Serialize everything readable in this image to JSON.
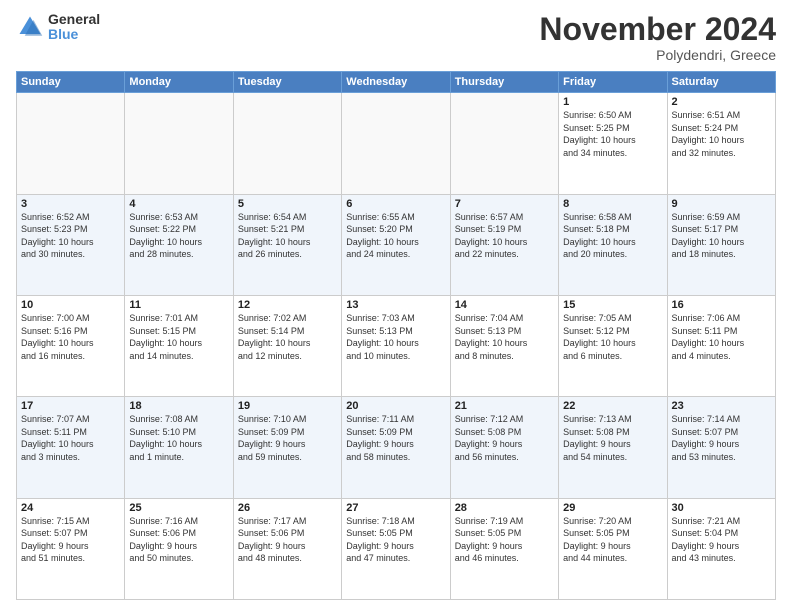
{
  "header": {
    "logo_general": "General",
    "logo_blue": "Blue",
    "month_title": "November 2024",
    "location": "Polydendri, Greece"
  },
  "days_of_week": [
    "Sunday",
    "Monday",
    "Tuesday",
    "Wednesday",
    "Thursday",
    "Friday",
    "Saturday"
  ],
  "weeks": [
    [
      {
        "day": "",
        "info": ""
      },
      {
        "day": "",
        "info": ""
      },
      {
        "day": "",
        "info": ""
      },
      {
        "day": "",
        "info": ""
      },
      {
        "day": "",
        "info": ""
      },
      {
        "day": "1",
        "info": "Sunrise: 6:50 AM\nSunset: 5:25 PM\nDaylight: 10 hours\nand 34 minutes."
      },
      {
        "day": "2",
        "info": "Sunrise: 6:51 AM\nSunset: 5:24 PM\nDaylight: 10 hours\nand 32 minutes."
      }
    ],
    [
      {
        "day": "3",
        "info": "Sunrise: 6:52 AM\nSunset: 5:23 PM\nDaylight: 10 hours\nand 30 minutes."
      },
      {
        "day": "4",
        "info": "Sunrise: 6:53 AM\nSunset: 5:22 PM\nDaylight: 10 hours\nand 28 minutes."
      },
      {
        "day": "5",
        "info": "Sunrise: 6:54 AM\nSunset: 5:21 PM\nDaylight: 10 hours\nand 26 minutes."
      },
      {
        "day": "6",
        "info": "Sunrise: 6:55 AM\nSunset: 5:20 PM\nDaylight: 10 hours\nand 24 minutes."
      },
      {
        "day": "7",
        "info": "Sunrise: 6:57 AM\nSunset: 5:19 PM\nDaylight: 10 hours\nand 22 minutes."
      },
      {
        "day": "8",
        "info": "Sunrise: 6:58 AM\nSunset: 5:18 PM\nDaylight: 10 hours\nand 20 minutes."
      },
      {
        "day": "9",
        "info": "Sunrise: 6:59 AM\nSunset: 5:17 PM\nDaylight: 10 hours\nand 18 minutes."
      }
    ],
    [
      {
        "day": "10",
        "info": "Sunrise: 7:00 AM\nSunset: 5:16 PM\nDaylight: 10 hours\nand 16 minutes."
      },
      {
        "day": "11",
        "info": "Sunrise: 7:01 AM\nSunset: 5:15 PM\nDaylight: 10 hours\nand 14 minutes."
      },
      {
        "day": "12",
        "info": "Sunrise: 7:02 AM\nSunset: 5:14 PM\nDaylight: 10 hours\nand 12 minutes."
      },
      {
        "day": "13",
        "info": "Sunrise: 7:03 AM\nSunset: 5:13 PM\nDaylight: 10 hours\nand 10 minutes."
      },
      {
        "day": "14",
        "info": "Sunrise: 7:04 AM\nSunset: 5:13 PM\nDaylight: 10 hours\nand 8 minutes."
      },
      {
        "day": "15",
        "info": "Sunrise: 7:05 AM\nSunset: 5:12 PM\nDaylight: 10 hours\nand 6 minutes."
      },
      {
        "day": "16",
        "info": "Sunrise: 7:06 AM\nSunset: 5:11 PM\nDaylight: 10 hours\nand 4 minutes."
      }
    ],
    [
      {
        "day": "17",
        "info": "Sunrise: 7:07 AM\nSunset: 5:11 PM\nDaylight: 10 hours\nand 3 minutes."
      },
      {
        "day": "18",
        "info": "Sunrise: 7:08 AM\nSunset: 5:10 PM\nDaylight: 10 hours\nand 1 minute."
      },
      {
        "day": "19",
        "info": "Sunrise: 7:10 AM\nSunset: 5:09 PM\nDaylight: 9 hours\nand 59 minutes."
      },
      {
        "day": "20",
        "info": "Sunrise: 7:11 AM\nSunset: 5:09 PM\nDaylight: 9 hours\nand 58 minutes."
      },
      {
        "day": "21",
        "info": "Sunrise: 7:12 AM\nSunset: 5:08 PM\nDaylight: 9 hours\nand 56 minutes."
      },
      {
        "day": "22",
        "info": "Sunrise: 7:13 AM\nSunset: 5:08 PM\nDaylight: 9 hours\nand 54 minutes."
      },
      {
        "day": "23",
        "info": "Sunrise: 7:14 AM\nSunset: 5:07 PM\nDaylight: 9 hours\nand 53 minutes."
      }
    ],
    [
      {
        "day": "24",
        "info": "Sunrise: 7:15 AM\nSunset: 5:07 PM\nDaylight: 9 hours\nand 51 minutes."
      },
      {
        "day": "25",
        "info": "Sunrise: 7:16 AM\nSunset: 5:06 PM\nDaylight: 9 hours\nand 50 minutes."
      },
      {
        "day": "26",
        "info": "Sunrise: 7:17 AM\nSunset: 5:06 PM\nDaylight: 9 hours\nand 48 minutes."
      },
      {
        "day": "27",
        "info": "Sunrise: 7:18 AM\nSunset: 5:05 PM\nDaylight: 9 hours\nand 47 minutes."
      },
      {
        "day": "28",
        "info": "Sunrise: 7:19 AM\nSunset: 5:05 PM\nDaylight: 9 hours\nand 46 minutes."
      },
      {
        "day": "29",
        "info": "Sunrise: 7:20 AM\nSunset: 5:05 PM\nDaylight: 9 hours\nand 44 minutes."
      },
      {
        "day": "30",
        "info": "Sunrise: 7:21 AM\nSunset: 5:04 PM\nDaylight: 9 hours\nand 43 minutes."
      }
    ]
  ]
}
